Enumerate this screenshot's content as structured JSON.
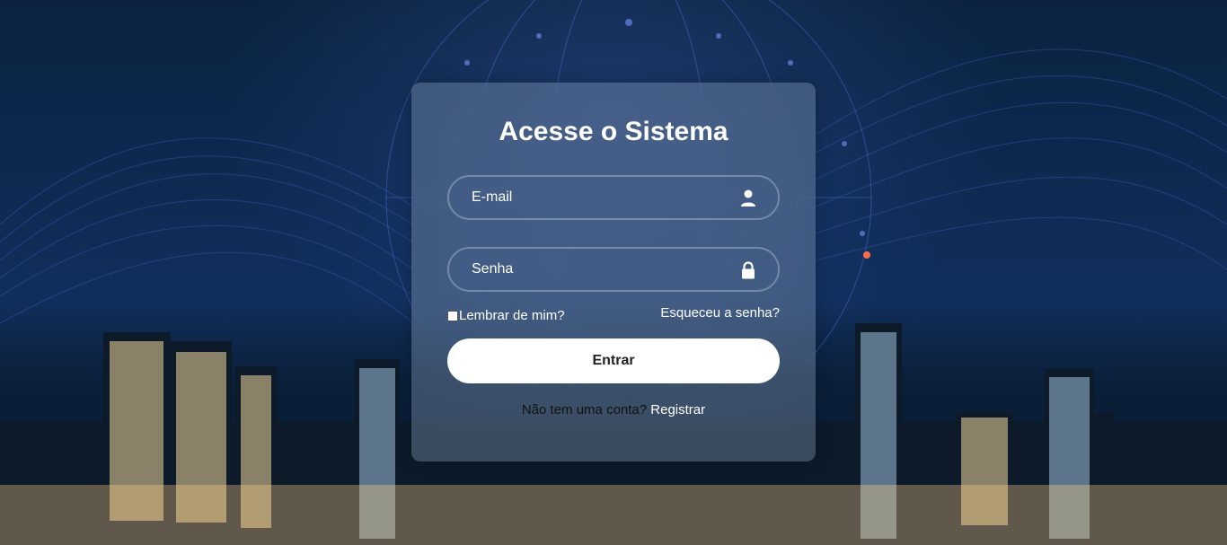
{
  "login": {
    "title": "Acesse o Sistema",
    "email_placeholder": "E-mail",
    "password_placeholder": "Senha",
    "remember_label": "Lembrar de mim?",
    "forgot_label": "Esqueceu a senha?",
    "submit_label": "Entrar",
    "register_prompt": "Não tem uma conta?",
    "register_link": "Registrar"
  },
  "icons": {
    "email": "user-icon",
    "password": "lock-icon"
  },
  "colors": {
    "card_bg": "rgba(150,170,195,0.35)",
    "button_bg": "#ffffff",
    "text": "#ffffff"
  }
}
